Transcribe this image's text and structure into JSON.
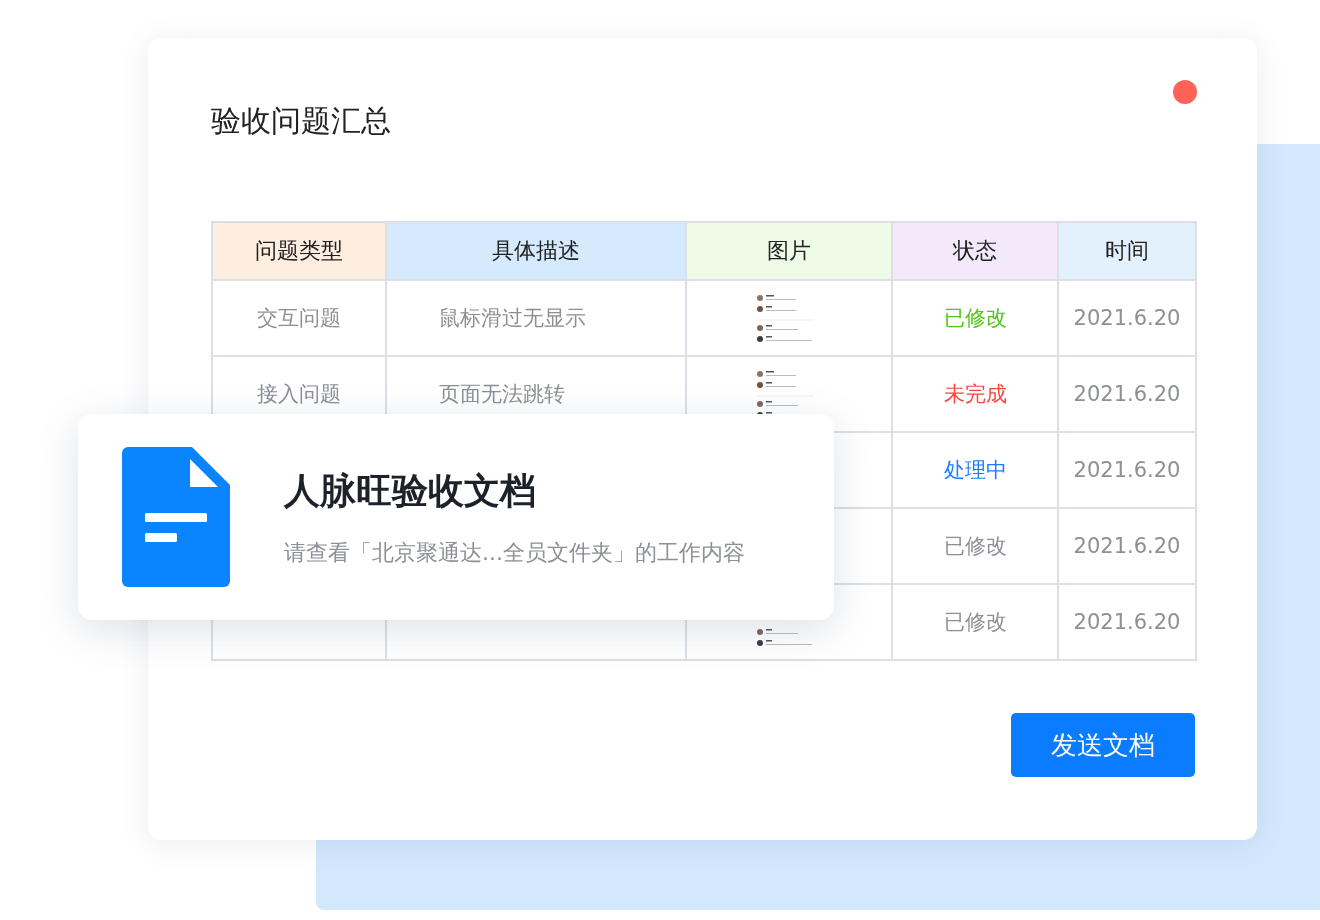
{
  "dialog": {
    "title": "验收问题汇总"
  },
  "table": {
    "columns": [
      {
        "label": "问题类型",
        "color": "#fdeee0"
      },
      {
        "label": "具体描述",
        "color": "#d6eafd"
      },
      {
        "label": "图片",
        "color": "#eefbe6"
      },
      {
        "label": "状态",
        "color": "#f4e9fb"
      },
      {
        "label": "时间",
        "color": "#e3f1fd"
      }
    ],
    "rows": [
      {
        "type": "交互问题",
        "description": "鼠标滑过无显示",
        "thumbnail": true,
        "status": "已修改",
        "color": "#52c41a",
        "time": "2021.6.20"
      },
      {
        "type": "接入问题",
        "description": "页面无法跳转",
        "thumbnail": true,
        "status": "未完成",
        "color": "#f5453d",
        "time": "2021.6.20"
      },
      {
        "thumbnail": false,
        "status": "处理中",
        "color": "#1a7cff",
        "time": "2021.6.20"
      },
      {
        "thumbnail": false,
        "status": "已修改",
        "color": "#8c8f96",
        "time": "2021.6.20"
      },
      {
        "thumbnail": true,
        "thumbnail_cropped": true,
        "status": "已修改",
        "color": "#8c8f96",
        "time": "2021.6.20"
      }
    ]
  },
  "send_button": "发送文档",
  "document_card": {
    "title": "人脉旺验收文档",
    "subtitle": "请查看「北京聚通达...全员文件夹」的工作内容"
  }
}
